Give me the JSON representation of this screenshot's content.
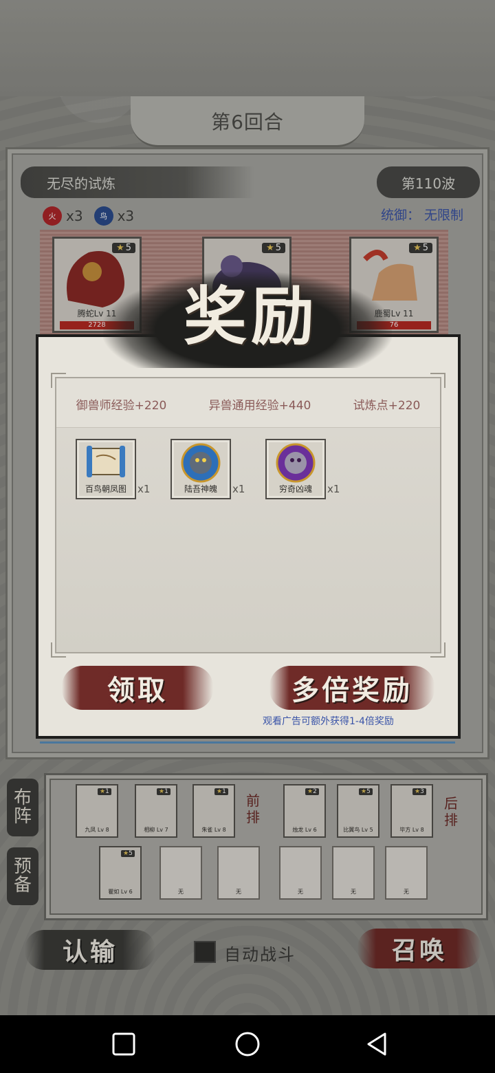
{
  "header": {
    "round": "第6回合"
  },
  "trial": {
    "title": "无尽的试炼",
    "wave": "第110波",
    "elements": [
      {
        "icon": "fire-element-icon",
        "glyph": "火",
        "count": "x3",
        "color": "#b0262a"
      },
      {
        "icon": "bird-element-icon",
        "glyph": "鸟",
        "count": "x3",
        "color": "#2b4c8e"
      }
    ],
    "command": "统御： 无限制",
    "enemies": [
      {
        "stars": "5",
        "name": "腾蛇Lv 11",
        "hp": "2728"
      },
      {
        "stars": "5",
        "name": "",
        "hp": ""
      },
      {
        "stars": "5",
        "name": "鹿蜀Lv 11",
        "hp": "76"
      }
    ]
  },
  "reward": {
    "title": "奖励",
    "exp": [
      "御兽师经验+220",
      "异兽通用经验+440",
      "试炼点+220"
    ],
    "items": [
      {
        "name": "百鸟朝凤图",
        "qty": "x1",
        "icon": "scroll-icon"
      },
      {
        "name": "陆吾神魄",
        "qty": "x1",
        "icon": "blue-spirit-orb-icon"
      },
      {
        "name": "穷奇凶魂",
        "qty": "x1",
        "icon": "purple-spirit-orb-icon"
      }
    ],
    "claim_label": "领取",
    "multi_label": "多倍奖励",
    "ad_note": "观看广告可额外获得1-4倍奖励"
  },
  "team": {
    "formation_tab": [
      "布",
      "阵"
    ],
    "reserve_tab": [
      "预",
      "备"
    ],
    "front_label": [
      "前",
      "排"
    ],
    "back_label": [
      "后",
      "排"
    ],
    "front_row": [
      {
        "name": "九凤 Lv 8",
        "stars": "1"
      },
      {
        "name": "相柳 Lv 7",
        "stars": "1"
      },
      {
        "name": "朱雀 Lv 8",
        "stars": "1"
      }
    ],
    "back_row": [
      {
        "name": "烛龙 Lv 6",
        "stars": "2"
      },
      {
        "name": "比翼鸟 Lv 5",
        "stars": "5"
      },
      {
        "name": "毕方 Lv 8",
        "stars": "3"
      }
    ],
    "reserve_row": [
      {
        "name": "瞿如 Lv 6",
        "stars": "5"
      },
      {
        "name": "无",
        "stars": ""
      },
      {
        "name": "无",
        "stars": ""
      },
      {
        "name": "无",
        "stars": ""
      },
      {
        "name": "无",
        "stars": ""
      },
      {
        "name": "无",
        "stars": ""
      }
    ]
  },
  "footer": {
    "surrender_label": "认输",
    "auto_battle_label": "自动战斗",
    "summon_label": "召唤"
  },
  "nav": {
    "recents": "recents-square-icon",
    "home": "home-circle-icon",
    "back": "back-triangle-icon"
  }
}
